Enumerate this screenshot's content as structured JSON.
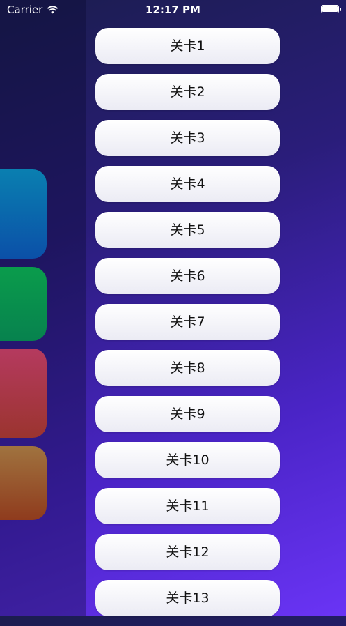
{
  "status_bar": {
    "carrier": "Carrier",
    "time": "12:17 PM",
    "wifi_icon": "wifi-icon",
    "battery_icon": "battery-icon"
  },
  "left_panel": {
    "tiles": [
      {
        "color": "#0a6db0"
      },
      {
        "color": "#08904e"
      },
      {
        "color": "#a63746"
      },
      {
        "color": "#995530"
      }
    ]
  },
  "levels": [
    {
      "label": "关卡1"
    },
    {
      "label": "关卡2"
    },
    {
      "label": "关卡3"
    },
    {
      "label": "关卡4"
    },
    {
      "label": "关卡5"
    },
    {
      "label": "关卡6"
    },
    {
      "label": "关卡7"
    },
    {
      "label": "关卡8"
    },
    {
      "label": "关卡9"
    },
    {
      "label": "关卡10"
    },
    {
      "label": "关卡11"
    },
    {
      "label": "关卡12"
    },
    {
      "label": "关卡13"
    }
  ],
  "colors": {
    "background_top": "#1b1d4f",
    "background_bottom": "#6a34f5",
    "button_bg": "#f3f3f8",
    "button_text": "#111111"
  }
}
